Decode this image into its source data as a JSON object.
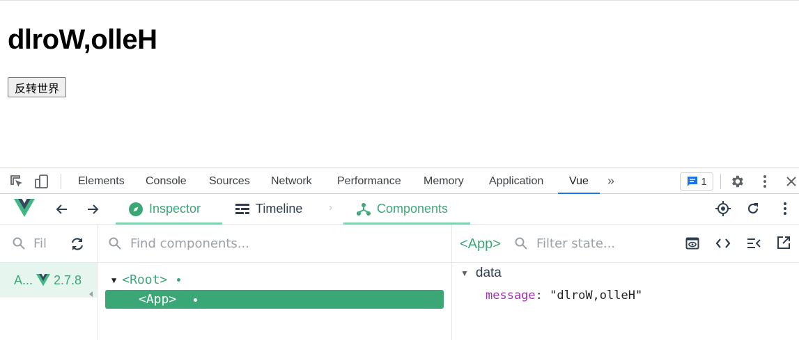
{
  "page": {
    "heading": "dlroW,olleH",
    "button_label": "反转世界"
  },
  "devtools": {
    "tabs": [
      {
        "label": "Elements"
      },
      {
        "label": "Console"
      },
      {
        "label": "Sources"
      },
      {
        "label": "Network"
      },
      {
        "label": "Performance"
      },
      {
        "label": "Memory"
      },
      {
        "label": "Application"
      },
      {
        "label": "Vue",
        "active": true
      }
    ],
    "more_tabs": "»",
    "issues_count": "1"
  },
  "vue_toolbar": {
    "inspector_label": "Inspector",
    "timeline_label": "Timeline",
    "components_label": "Components"
  },
  "apps_panel": {
    "search_placeholder": "Fil",
    "app_name": "A...",
    "vue_version": "2.7.8"
  },
  "tree_panel": {
    "search_placeholder": "Find components...",
    "root_label": "<Root>",
    "app_label": "<App>"
  },
  "state_panel": {
    "selected_component": "<App>",
    "filter_placeholder": "Filter state...",
    "section": "data",
    "fields": [
      {
        "key": "message",
        "value": "\"dlroW,olleH\""
      }
    ]
  },
  "colors": {
    "vue_green": "#3ba776",
    "chrome_blue": "#1a73e8",
    "key_purple": "#a42fb5"
  }
}
